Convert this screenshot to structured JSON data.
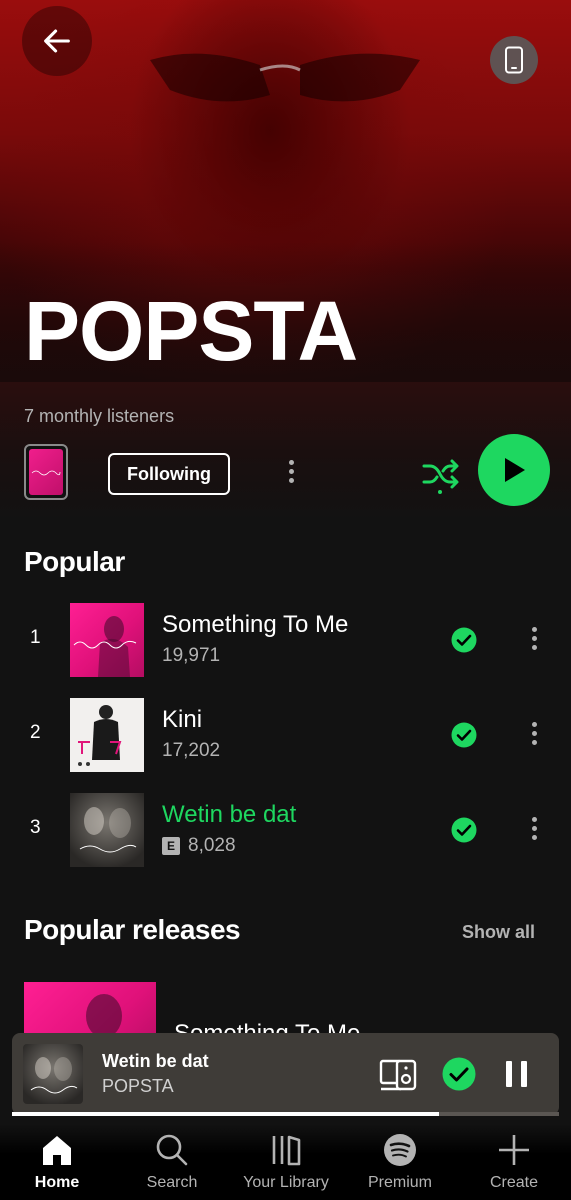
{
  "artist": {
    "name": "POPSTA",
    "monthly_listeners": "7 monthly listeners",
    "following_label": "Following"
  },
  "popular": {
    "title": "Popular",
    "tracks": [
      {
        "rank": "1",
        "title": "Something To Me",
        "plays": "19,971",
        "explicit": false,
        "playing": false,
        "saved": true
      },
      {
        "rank": "2",
        "title": "Kini",
        "plays": "17,202",
        "explicit": false,
        "playing": false,
        "saved": true
      },
      {
        "rank": "3",
        "title": "Wetin be dat",
        "plays": "8,028",
        "explicit": true,
        "playing": true,
        "saved": true
      }
    ],
    "explicit_badge": "E"
  },
  "popular_releases": {
    "title": "Popular releases",
    "show_all": "Show all",
    "first_release_title": "Something To Me"
  },
  "now_playing": {
    "title": "Wetin be dat",
    "artist": "POPSTA",
    "progress": 0.78
  },
  "nav": {
    "home": "Home",
    "search": "Search",
    "library": "Your Library",
    "premium": "Premium",
    "create": "Create"
  },
  "colors": {
    "accent": "#1ed760",
    "background": "#121212",
    "hero_red": "#9a0d0d"
  },
  "icons": {
    "back": "arrow-left-icon",
    "device": "phone-device-icon",
    "shuffle": "shuffle-icon",
    "play": "play-icon",
    "check": "check-circle-icon",
    "more": "more-vertical-icon",
    "connect": "speaker-device-icon",
    "pause": "pause-icon"
  }
}
